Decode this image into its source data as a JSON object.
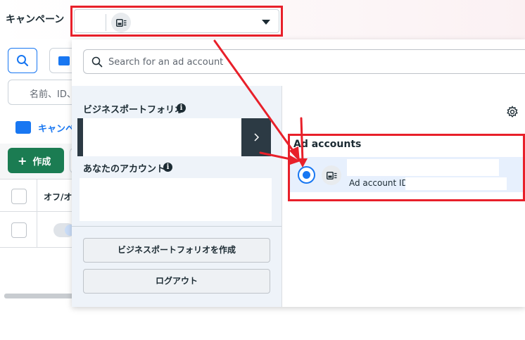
{
  "header": {
    "page_title": "キャンペーン"
  },
  "background_page": {
    "search_placeholder": "名前、ID、",
    "campaign_tab_label": "キャンペー",
    "create_button_label": "作成",
    "table_header_label": "オフ/オ"
  },
  "dropdown": {
    "search_placeholder": "Search for an ad account",
    "business_portfolio_title": "ビジネスポートフォリオ",
    "your_accounts_title": "あなたのアカウント",
    "create_portfolio_button": "ビジネスポートフォリオを作成",
    "logout_button": "ログアウト",
    "ad_accounts": {
      "title": "Ad accounts",
      "selected": true,
      "account_id_label": "Ad account ID:"
    }
  },
  "icons": {
    "info": "i",
    "plus": "+",
    "chevron": "›"
  },
  "colors": {
    "annotation_red": "#e8202a",
    "accent_blue": "#1877f2",
    "create_green": "#1b7c52",
    "portfolio_dark": "#2c3a44"
  }
}
